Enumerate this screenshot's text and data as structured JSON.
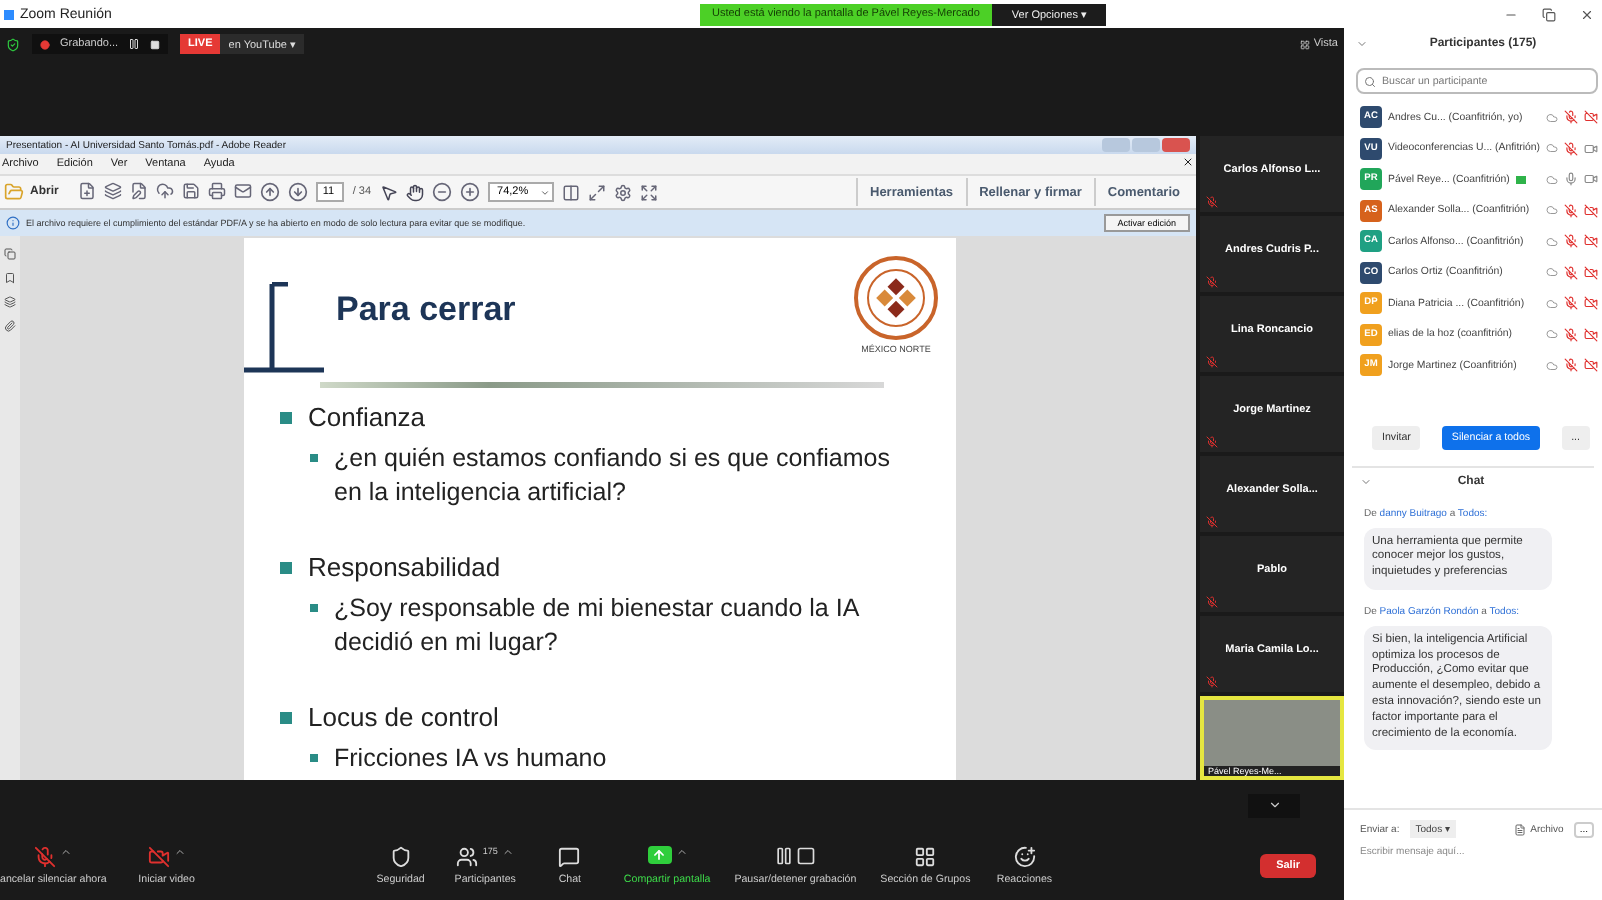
{
  "window": {
    "title": "Zoom Reunión",
    "banner": "Usted está viendo la pantalla de Pável Reyes-Mercado",
    "view_options": "Ver Opciones ▾"
  },
  "meeting_bar": {
    "recording": "Grabando...",
    "live": "LIVE",
    "live_target": "en YouTube ▾",
    "view": "Vista"
  },
  "shared_app": {
    "title": "Presentation - AI Universidad Santo Tomás.pdf - Adobe Reader",
    "menu": [
      "Archivo",
      "Edición",
      "Ver",
      "Ventana",
      "Ayuda"
    ],
    "open": "Abrir",
    "page": "11",
    "page_count": "/ 34",
    "zoom": "74,2%",
    "tools": [
      "Herramientas",
      "Rellenar y firmar",
      "Comentario"
    ],
    "notice": "El archivo requiere el cumplimiento del estándar PDF/A y se ha abierto en modo de solo lectura para evitar que se modifique.",
    "notice_button": "Activar edición"
  },
  "slide": {
    "title": "Para cerrar",
    "logo_caption": "MÉXICO NORTE",
    "bullets": [
      {
        "text": "Confianza",
        "children": [
          {
            "text": "¿en quién estamos confiando si es que confiamos en la inteligencia artificial?"
          }
        ]
      },
      {
        "text": "Responsabilidad",
        "children": [
          {
            "text": "¿Soy responsable de mi bienestar cuando la IA decidió en mi lugar?"
          }
        ]
      },
      {
        "text": "Locus de control",
        "children": [
          {
            "text": "Fricciones IA vs humano"
          }
        ]
      }
    ]
  },
  "gallery": [
    {
      "kind": "name",
      "name": "Carlos Alfonso L...",
      "muted": true,
      "speaking": false
    },
    {
      "kind": "name",
      "name": "Andres Cudris P...",
      "muted": true,
      "speaking": false
    },
    {
      "kind": "name",
      "name": "Lina Roncancio",
      "muted": true,
      "speaking": false
    },
    {
      "kind": "name",
      "name": "Jorge Martinez",
      "muted": true,
      "speaking": false
    },
    {
      "kind": "name",
      "name": "Alexander Solla...",
      "muted": true,
      "speaking": false
    },
    {
      "kind": "name",
      "name": "Pablo",
      "muted": true,
      "speaking": false
    },
    {
      "kind": "name",
      "name": "Maria Camila Lo...",
      "muted": true,
      "speaking": false
    },
    {
      "kind": "video",
      "name": "Pável Reyes-Me...",
      "muted": false,
      "speaking": true
    }
  ],
  "toolbar": {
    "left_items": [
      {
        "kind": "mic",
        "label": "ancelar silenciar ahora",
        "off": true,
        "caret": true,
        "active": false
      },
      {
        "kind": "video",
        "label": "Iniciar video",
        "off": true,
        "caret": true,
        "active": false
      }
    ],
    "center_items": [
      {
        "kind": "security",
        "label": "Seguridad",
        "caret": false,
        "active": false
      },
      {
        "kind": "participants",
        "label": "Participantes",
        "count": "175",
        "caret": true,
        "active": false
      },
      {
        "kind": "chat",
        "label": "Chat",
        "caret": false,
        "active": false
      },
      {
        "kind": "share",
        "label": "Compartir pantalla",
        "caret": true,
        "active": true
      },
      {
        "kind": "record",
        "label": "Pausar/detener grabación",
        "caret": false,
        "active": false
      },
      {
        "kind": "groups",
        "label": "Sección de Grupos",
        "caret": false,
        "active": false
      },
      {
        "kind": "reactions",
        "label": "Reacciones",
        "caret": false,
        "active": false
      }
    ],
    "leave": "Salir"
  },
  "participants": {
    "title": "Participantes (175)",
    "search_placeholder": "Buscar un participante",
    "rows": [
      {
        "initials": "AC",
        "color": "#2e4a6e",
        "name": "Andres Cu... (Coanfitrión, yo)",
        "sharing": false,
        "mic_muted": true,
        "video_off": true
      },
      {
        "initials": "VU",
        "color": "#2e4a6e",
        "name": "Videoconferencias U... (Anfitrión)",
        "sharing": false,
        "mic_muted": true,
        "video_off": false
      },
      {
        "initials": "PR",
        "color": "#21a65a",
        "name": "Pável Reye... (Coanfitrión)",
        "sharing": true,
        "mic_muted": false,
        "video_off": false
      },
      {
        "initials": "AS",
        "color": "#d6621c",
        "name": "Alexander Solla... (Coanfitrión)",
        "sharing": false,
        "mic_muted": true,
        "video_off": true
      },
      {
        "initials": "CA",
        "color": "#1fa083",
        "name": "Carlos Alfonso... (Coanfitrión)",
        "sharing": false,
        "mic_muted": true,
        "video_off": true
      },
      {
        "initials": "CO",
        "color": "#2e4a6e",
        "name": "Carlos Ortiz (Coanfitrión)",
        "sharing": false,
        "mic_muted": true,
        "video_off": true
      },
      {
        "initials": "DP",
        "color": "#f0a01e",
        "name": "Diana Patricia ... (Coanfitrión)",
        "sharing": false,
        "mic_muted": true,
        "video_off": true
      },
      {
        "initials": "ED",
        "color": "#f0a01e",
        "name": "elias de la hoz (coanfitrión)",
        "sharing": false,
        "mic_muted": true,
        "video_off": true
      },
      {
        "initials": "JM",
        "color": "#f0a01e",
        "name": "Jorge Martinez (Coanfitrión)",
        "sharing": false,
        "mic_muted": true,
        "video_off": true
      }
    ],
    "buttons": [
      {
        "kind": "plain",
        "label": "Invitar"
      },
      {
        "kind": "primary",
        "label": "Silenciar a todos"
      },
      {
        "kind": "plain",
        "label": "..."
      }
    ]
  },
  "chat": {
    "title": "Chat",
    "messages": [
      {
        "prefix": "De",
        "from": "danny Buitrago",
        "joiner": "a",
        "to": "Todos:",
        "text": "Una herramienta que permite conocer mejor los gustos, inquietudes y preferencias"
      },
      {
        "prefix": "De",
        "from": "Paola Garzón Rondón",
        "joiner": "a",
        "to": "Todos:",
        "text": "Si bien, la inteligencia Artificial optimiza los procesos de Producción, ¿Como evitar que aumente el desempleo, debido a esta innovación?, siendo este un factor importante para el crecimiento de la economía."
      }
    ],
    "send_to_label": "Enviar a:",
    "send_to": "Todos ▾",
    "file": "Archivo",
    "more": "...",
    "placeholder": "Escribir mensaje aquí..."
  }
}
